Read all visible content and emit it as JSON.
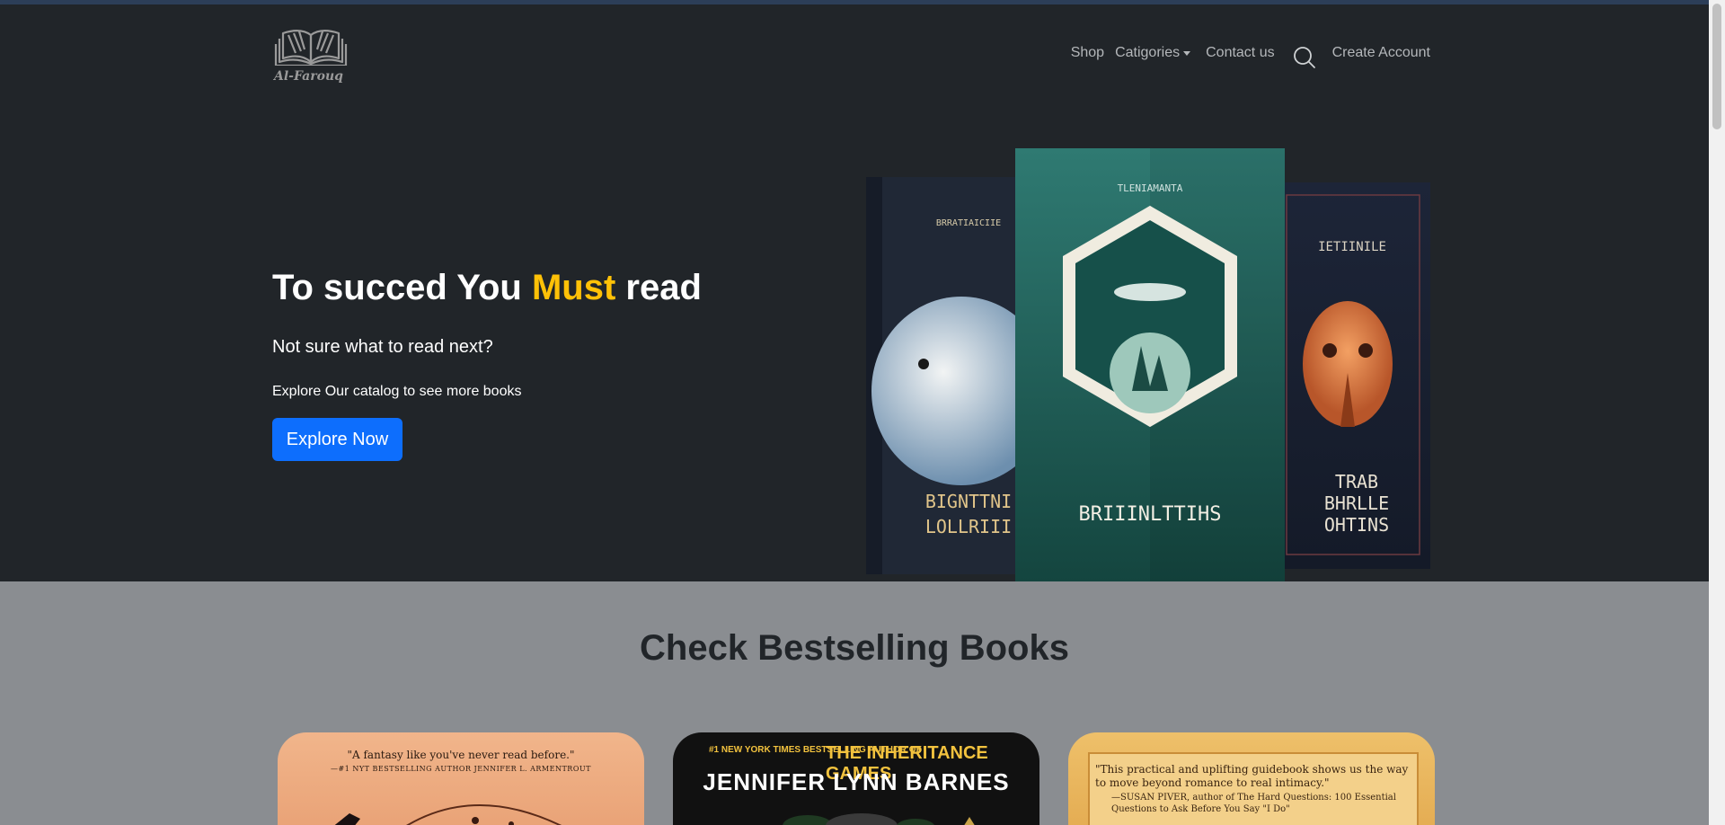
{
  "brand": {
    "name": "Al-Farouq",
    "logo_icon": "open-book-icon"
  },
  "nav": {
    "shop": "Shop",
    "categories": "Catigories",
    "contact": "Contact us",
    "search_icon": "search-icon",
    "create_account": "Create Account"
  },
  "hero": {
    "title_part1": "To succed You ",
    "title_accent": "Must",
    "title_part2": " read",
    "subtitle": "Not sure what to read next?",
    "text": "Explore Our catalog to see more books",
    "button": "Explore Now",
    "accent_color": "#ffc107",
    "button_color": "#0d6efd",
    "books": [
      {
        "title": "BIGNTTNI LOLLRIII",
        "header": "BRRATIAICIIE"
      },
      {
        "title": "BRIIINLTTIHS",
        "header": "TLENIAMANTA"
      },
      {
        "title": "TRAB BHRLLE OHTINS",
        "header": "IETIINILE"
      }
    ]
  },
  "bestsellers": {
    "heading": "Check Bestselling Books",
    "books": [
      {
        "quote": "\"A fantasy like you've never read before.\"",
        "attribution": "—#1 NYT BESTSELLING AUTHOR JENNIFER L. ARMENTROUT"
      },
      {
        "tagline": "#1 NEW YORK TIMES BESTSELLING AUTHOR OF",
        "series": "THE INHERITANCE GAMES",
        "author": "JENNIFER LYNN BARNES"
      },
      {
        "quote": "\"This practical and uplifting guidebook shows us the way to move beyond romance to real intimacy.\"",
        "attribution": "—SUSAN PIVER, author of The Hard Questions: 100 Essential Questions to Ask Before You Say \"I Do\""
      }
    ]
  }
}
